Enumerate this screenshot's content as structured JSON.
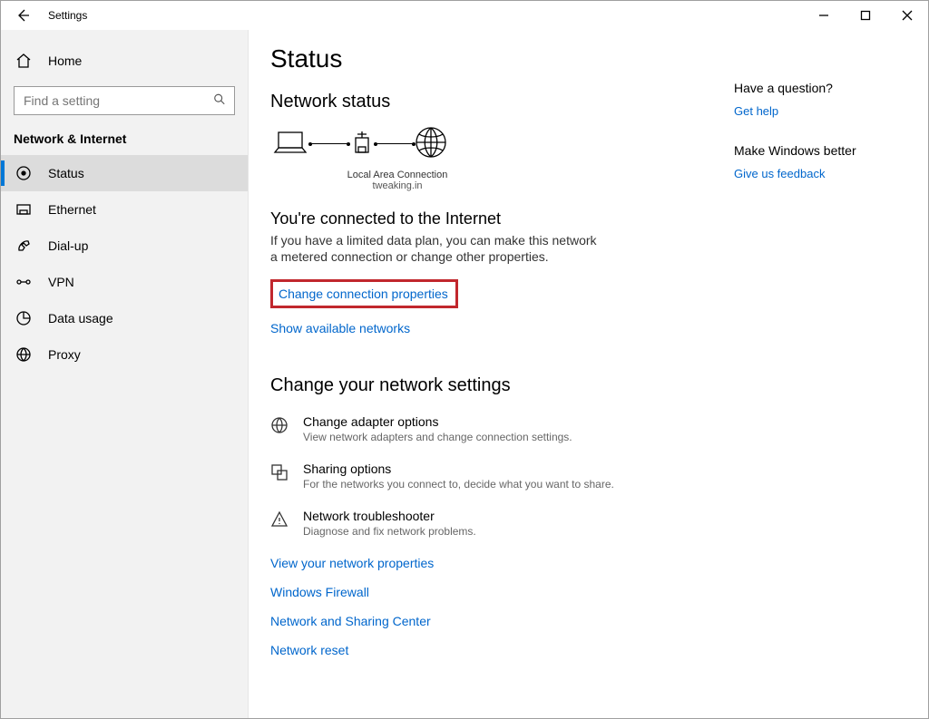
{
  "titlebar": {
    "title": "Settings"
  },
  "sidebar": {
    "home": "Home",
    "search_placeholder": "Find a setting",
    "category": "Network & Internet",
    "items": [
      {
        "label": "Status"
      },
      {
        "label": "Ethernet"
      },
      {
        "label": "Dial-up"
      },
      {
        "label": "VPN"
      },
      {
        "label": "Data usage"
      },
      {
        "label": "Proxy"
      }
    ]
  },
  "main": {
    "heading": "Status",
    "section_status": "Network status",
    "diagram": {
      "device": "Local Area Connection",
      "network": "tweaking.in"
    },
    "connected_title": "You're connected to the Internet",
    "connected_desc": "If you have a limited data plan, you can make this network a metered connection or change other properties.",
    "change_props": "Change connection properties",
    "show_networks": "Show available networks",
    "section_change": "Change your network settings",
    "settings": [
      {
        "title": "Change adapter options",
        "sub": "View network adapters and change connection settings."
      },
      {
        "title": "Sharing options",
        "sub": "For the networks you connect to, decide what you want to share."
      },
      {
        "title": "Network troubleshooter",
        "sub": "Diagnose and fix network problems."
      }
    ],
    "links": [
      "View your network properties",
      "Windows Firewall",
      "Network and Sharing Center",
      "Network reset"
    ]
  },
  "aside": {
    "q_title": "Have a question?",
    "q_link": "Get help",
    "f_title": "Make Windows better",
    "f_link": "Give us feedback"
  }
}
